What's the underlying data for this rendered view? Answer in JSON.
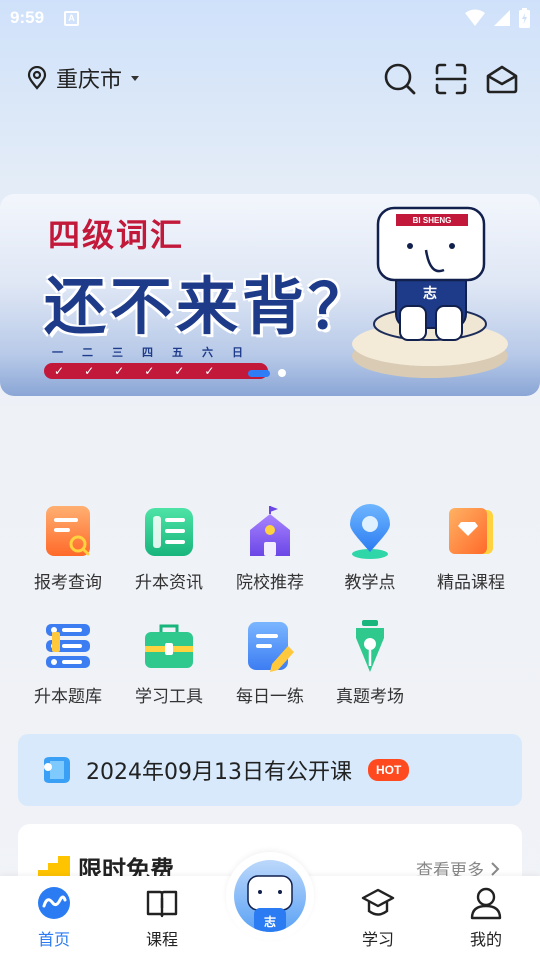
{
  "status_bar": {
    "time": "9:59",
    "notif_icon": "A"
  },
  "header": {
    "location": "重庆市"
  },
  "banner": {
    "subtitle": "四级词汇",
    "headline": "还不来背？",
    "days": [
      "一",
      "二",
      "三",
      "四",
      "五",
      "六",
      "日"
    ],
    "mascot_tag": "BI SHENG",
    "mascot_badge": "志"
  },
  "grid": [
    {
      "label": "报考查询",
      "icon": "search-doc-icon"
    },
    {
      "label": "升本资讯",
      "icon": "news-icon"
    },
    {
      "label": "院校推荐",
      "icon": "school-icon"
    },
    {
      "label": "教学点",
      "icon": "location-pin-icon"
    },
    {
      "label": "精品课程",
      "icon": "premium-course-icon"
    },
    {
      "label": "升本题库",
      "icon": "question-bank-icon"
    },
    {
      "label": "学习工具",
      "icon": "toolbox-icon"
    },
    {
      "label": "每日一练",
      "icon": "daily-practice-icon"
    },
    {
      "label": "真题考场",
      "icon": "exam-pen-icon"
    }
  ],
  "notice": {
    "text": "2024年09月13日有公开课",
    "badge": "HOT"
  },
  "free_section": {
    "title": "限时免费",
    "more": "查看更多"
  },
  "tabs": [
    {
      "label": "首页",
      "active": true
    },
    {
      "label": "课程",
      "active": false
    },
    {
      "label": "学习",
      "active": false
    },
    {
      "label": "我的",
      "active": false
    }
  ],
  "colors": {
    "accent": "#2b7cf2",
    "hot": "#ff4a1f",
    "banner_red": "#c2183a",
    "banner_blue": "#1e3b8a"
  }
}
